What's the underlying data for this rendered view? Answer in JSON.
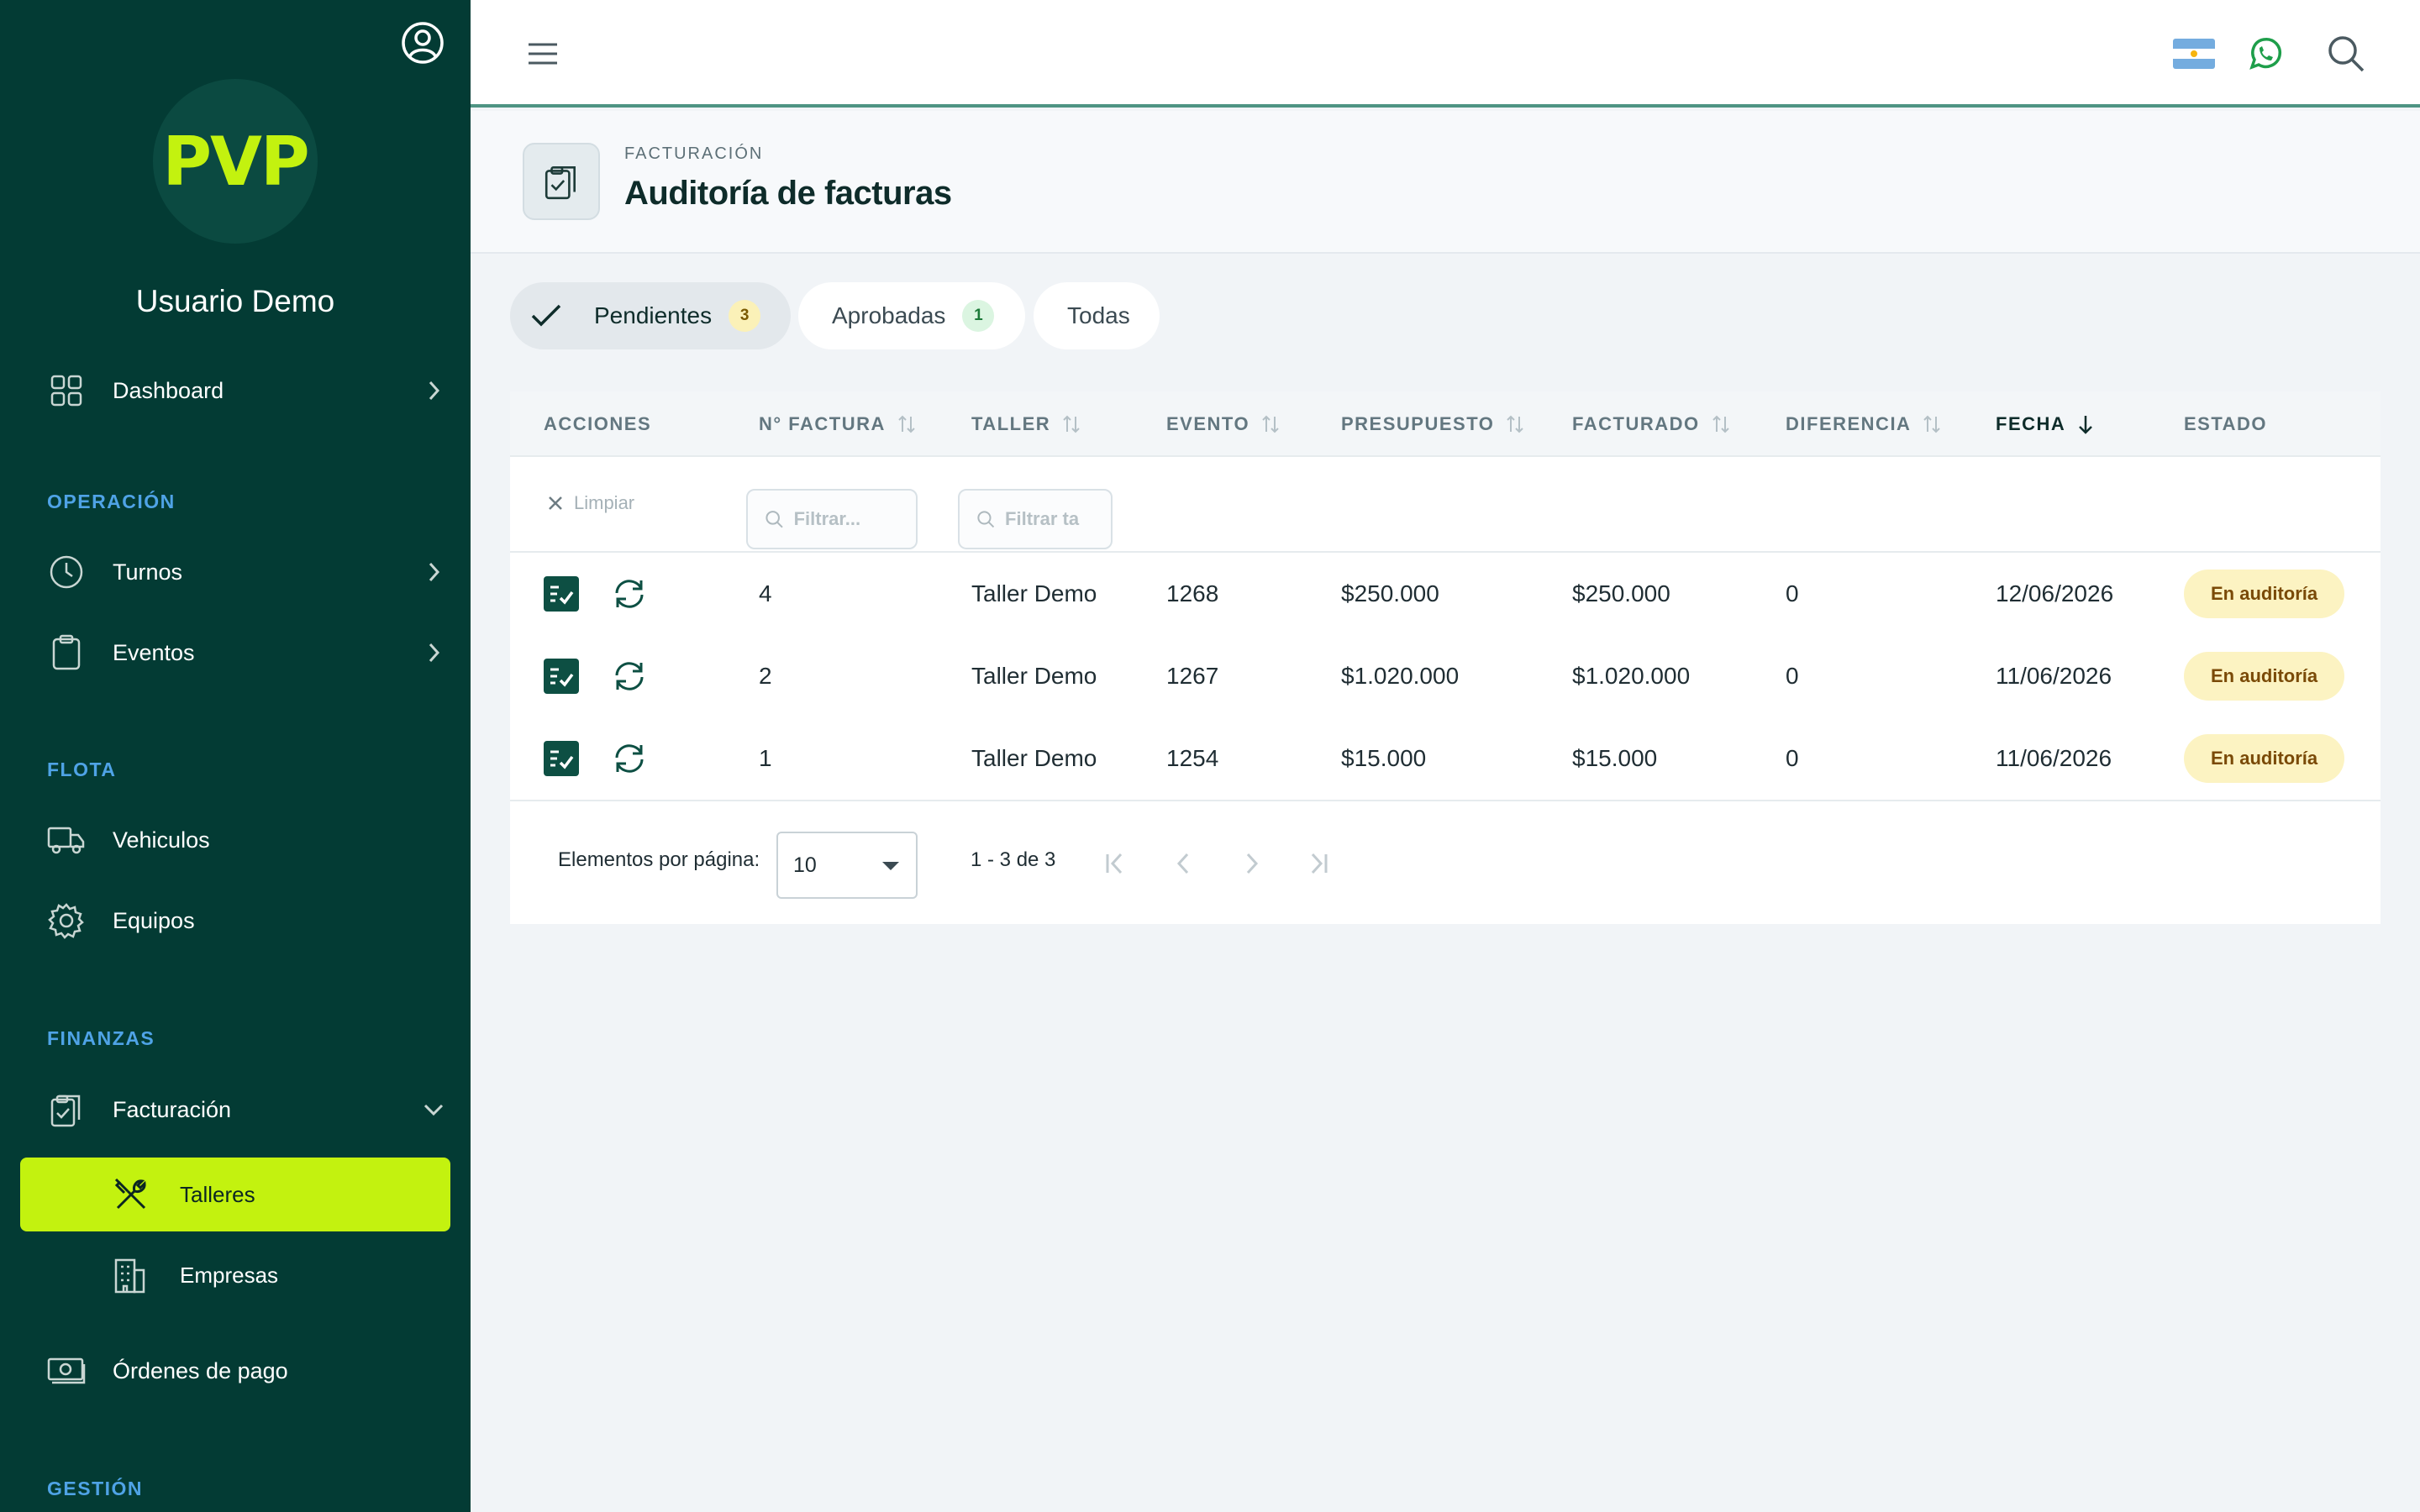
{
  "sidebar": {
    "logo_text": "PVP",
    "user_name": "Usuario Demo",
    "dashboard_label": "Dashboard",
    "sections": {
      "operacion": "OPERACIÓN",
      "flota": "FLOTA",
      "finanzas": "FINANZAS",
      "gestion": "GESTIÓN"
    },
    "items": {
      "turnos": "Turnos",
      "eventos": "Eventos",
      "vehiculos": "Vehiculos",
      "equipos": "Equipos",
      "facturacion": "Facturación",
      "talleres": "Talleres",
      "empresas": "Empresas",
      "ordenes": "Órdenes de pago"
    }
  },
  "header": {
    "breadcrumb": "FACTURACIÓN",
    "title": "Auditoría de facturas"
  },
  "tabs": [
    {
      "label": "Pendientes",
      "count": "3",
      "active": true
    },
    {
      "label": "Aprobadas",
      "count": "1",
      "active": false
    },
    {
      "label": "Todas",
      "active": false
    }
  ],
  "table": {
    "columns": {
      "acciones": "ACCIONES",
      "factura": "N° FACTURA",
      "taller": "TALLER",
      "evento": "EVENTO",
      "presupuesto": "PRESUPUESTO",
      "facturado": "FACTURADO",
      "diferencia": "DIFERENCIA",
      "fecha": "FECHA",
      "estado": "ESTADO"
    },
    "filters": {
      "clear_label": "Limpiar",
      "factura_placeholder": "Filtrar...",
      "taller_placeholder": "Filtrar ta"
    },
    "rows": [
      {
        "factura": "4",
        "taller": "Taller Demo",
        "evento": "1268",
        "presupuesto": "$250.000",
        "facturado": "$250.000",
        "diferencia": "0",
        "fecha": "12/06/2026",
        "estado": "En auditoría"
      },
      {
        "factura": "2",
        "taller": "Taller Demo",
        "evento": "1267",
        "presupuesto": "$1.020.000",
        "facturado": "$1.020.000",
        "diferencia": "0",
        "fecha": "11/06/2026",
        "estado": "En auditoría"
      },
      {
        "factura": "1",
        "taller": "Taller Demo",
        "evento": "1254",
        "presupuesto": "$15.000",
        "facturado": "$15.000",
        "diferencia": "0",
        "fecha": "11/06/2026",
        "estado": "En auditoría"
      }
    ],
    "footer": {
      "per_page_label": "Elementos por página:",
      "per_page_value": "10",
      "range": "1 - 3 de 3"
    }
  },
  "colors": {
    "sidebar_bg": "#033b34",
    "accent_lime": "#c3f20f",
    "section_blue": "#4fa3e6",
    "status_bg": "#fcf3c2",
    "action_green": "#0d4f43"
  }
}
